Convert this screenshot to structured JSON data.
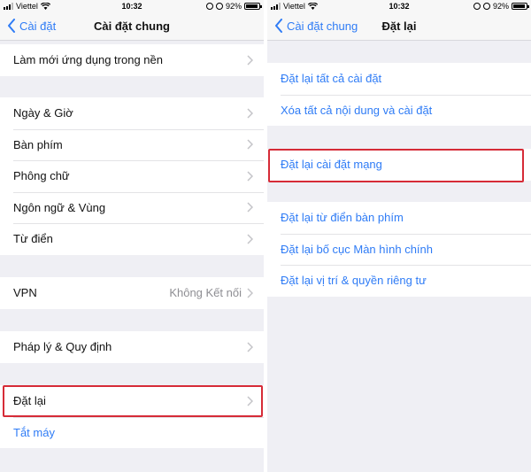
{
  "colors": {
    "accent": "#2f7cf6",
    "highlight": "#d62b37",
    "background": "#efeff4"
  },
  "left": {
    "status": {
      "carrier": "Viettel",
      "time": "10:32",
      "battery": "92%"
    },
    "nav": {
      "back_label": "Cài đặt",
      "title": "Cài đặt chung"
    },
    "groups": [
      {
        "rows": [
          {
            "label": "Làm mới ứng dụng trong nền"
          }
        ]
      },
      {
        "rows": [
          {
            "label": "Ngày & Giờ"
          },
          {
            "label": "Bàn phím"
          },
          {
            "label": "Phông chữ"
          },
          {
            "label": "Ngôn ngữ & Vùng"
          },
          {
            "label": "Từ điển"
          }
        ]
      },
      {
        "rows": [
          {
            "label": "VPN",
            "value": "Không Kết nối"
          }
        ]
      },
      {
        "rows": [
          {
            "label": "Pháp lý & Quy định"
          }
        ]
      },
      {
        "rows": [
          {
            "label": "Đặt lại"
          },
          {
            "label": "Tắt máy"
          }
        ]
      }
    ]
  },
  "right": {
    "status": {
      "carrier": "Viettel",
      "time": "10:32",
      "battery": "92%"
    },
    "nav": {
      "back_label": "Cài đặt chung",
      "title": "Đặt lại"
    },
    "groups": [
      {
        "rows": [
          {
            "label": "Đặt lại tất cả cài đặt"
          },
          {
            "label": "Xóa tất cả nội dung và cài đặt"
          }
        ]
      },
      {
        "rows": [
          {
            "label": "Đặt lại cài đặt mạng"
          }
        ]
      },
      {
        "rows": [
          {
            "label": "Đặt lại từ điển bàn phím"
          },
          {
            "label": "Đặt lại bố cục Màn hình chính"
          },
          {
            "label": "Đặt lại vị trí & quyền riêng tư"
          }
        ]
      }
    ]
  }
}
